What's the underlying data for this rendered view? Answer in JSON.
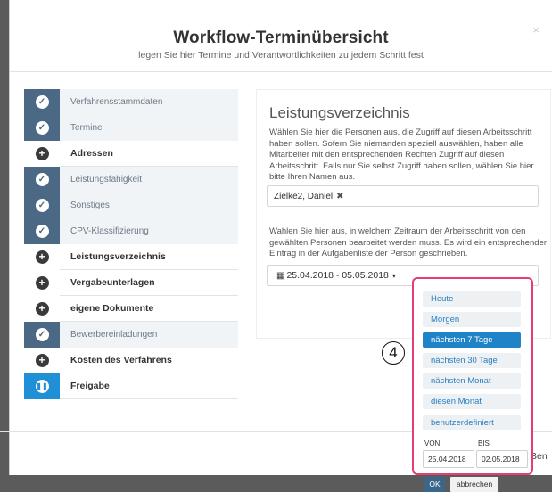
{
  "modal": {
    "title": "Workflow-Terminübersicht",
    "subtitle": "legen Sie hier Termine und Verantwortlichkeiten zu jedem Schritt fest",
    "close_icon": "×",
    "footer_button_partial": "Ben"
  },
  "steps": [
    {
      "label": "Verfahrensstammdaten",
      "state": "done"
    },
    {
      "label": "Termine",
      "state": "done"
    },
    {
      "label": "Adressen",
      "state": "open"
    },
    {
      "label": "Leistungsfähigkeit",
      "state": "done"
    },
    {
      "label": "Sonstiges",
      "state": "done"
    },
    {
      "label": "CPV-Klassifizierung",
      "state": "done"
    },
    {
      "label": "Leistungsverzeichnis",
      "state": "open"
    },
    {
      "label": "Vergabeunterlagen",
      "state": "open"
    },
    {
      "label": "eigene Dokumente",
      "state": "open"
    },
    {
      "label": "Bewerbereinladungen",
      "state": "done"
    },
    {
      "label": "Kosten des Verfahrens",
      "state": "open"
    },
    {
      "label": "Freigabe",
      "state": "active"
    }
  ],
  "content": {
    "title": "Leistungsverzeichnis",
    "text1": "Wählen Sie hier die Personen aus, die Zugriff auf diesen Arbeitsschritt haben sollen. Sofern Sie niemanden speziell auswählen, haben alle Mitarbeiter mit den entsprechenden Rechten Zugriff auf diesen Arbeitsschritt. Falls nur Sie selbst Zugriff haben sollen, wählen Sie hier bitte Ihren Namen aus.",
    "tag": "Zielke2, Daniel",
    "tag_remove": "✖",
    "text2": "Wahlen Sie hier aus, in welchem Zeitraum der Arbeitsschritt von den gewählten Personen bearbeitet werden muss. Es wird ein entsprechender Eintrag in der Aufgabenliste der Person geschrieben.",
    "date_range": "25.04.2018 - 05.05.2018",
    "calendar_icon": "▦",
    "caret": "▾"
  },
  "picker": {
    "ranges": [
      "Heute",
      "Morgen",
      "nächsten 7 Tage",
      "nächsten 30 Tage",
      "nächsten Monat",
      "diesen Monat",
      "benutzerdefiniert"
    ],
    "selected_index": 2,
    "from_label": "VON",
    "to_label": "BIS",
    "from_value": "25.04.2018",
    "to_value": "02.05.2018",
    "ok_label": "OK",
    "cancel_label": "abbrechen",
    "highlight_color": "#e43f73"
  },
  "annotation": {
    "marker": "4"
  },
  "colors": {
    "done": "#4b6884",
    "active": "#1f8fd6",
    "selected_range": "#1f83c8"
  }
}
